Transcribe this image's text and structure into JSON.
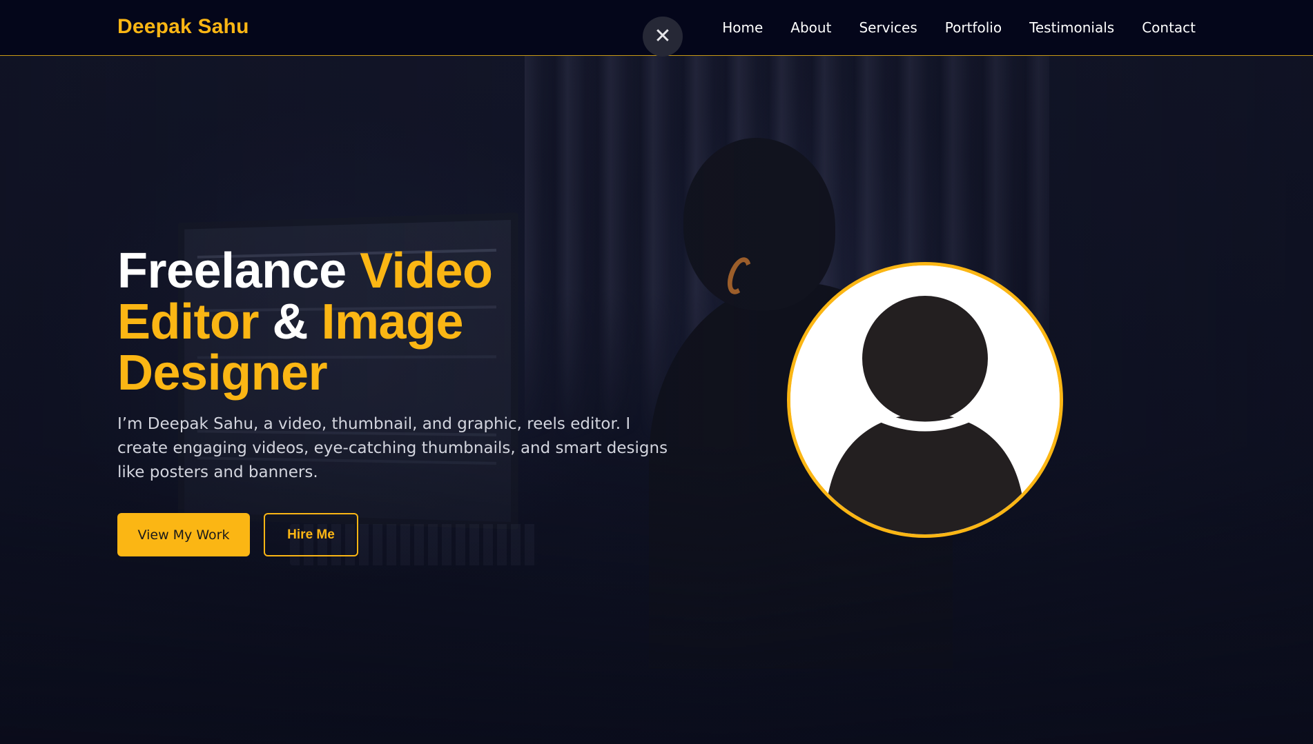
{
  "header": {
    "logo": "Deepak Sahu",
    "close_icon": "close-icon",
    "close_glyph": "✕",
    "nav": [
      "Home",
      "About",
      "Services",
      "Portfolio",
      "Testimonials",
      "Contact"
    ]
  },
  "hero": {
    "title_parts": [
      "Freelance ",
      "Video",
      "Editor",
      " & ",
      "Image",
      "Designer"
    ],
    "description": "I’m Deepak Sahu, a video, thumbnail, and graphic, reels editor. I create engaging videos, eye-catching thumbnails, and smart designs like posters and banners.",
    "primary_button": "View My Work",
    "secondary_button": "Hire Me"
  },
  "avatar": {
    "icon": "user-silhouette-icon"
  },
  "colors": {
    "accent": "#fbb614",
    "header_bg": "#04061a",
    "background": "#0b0e1c",
    "text": "#ffffff"
  }
}
